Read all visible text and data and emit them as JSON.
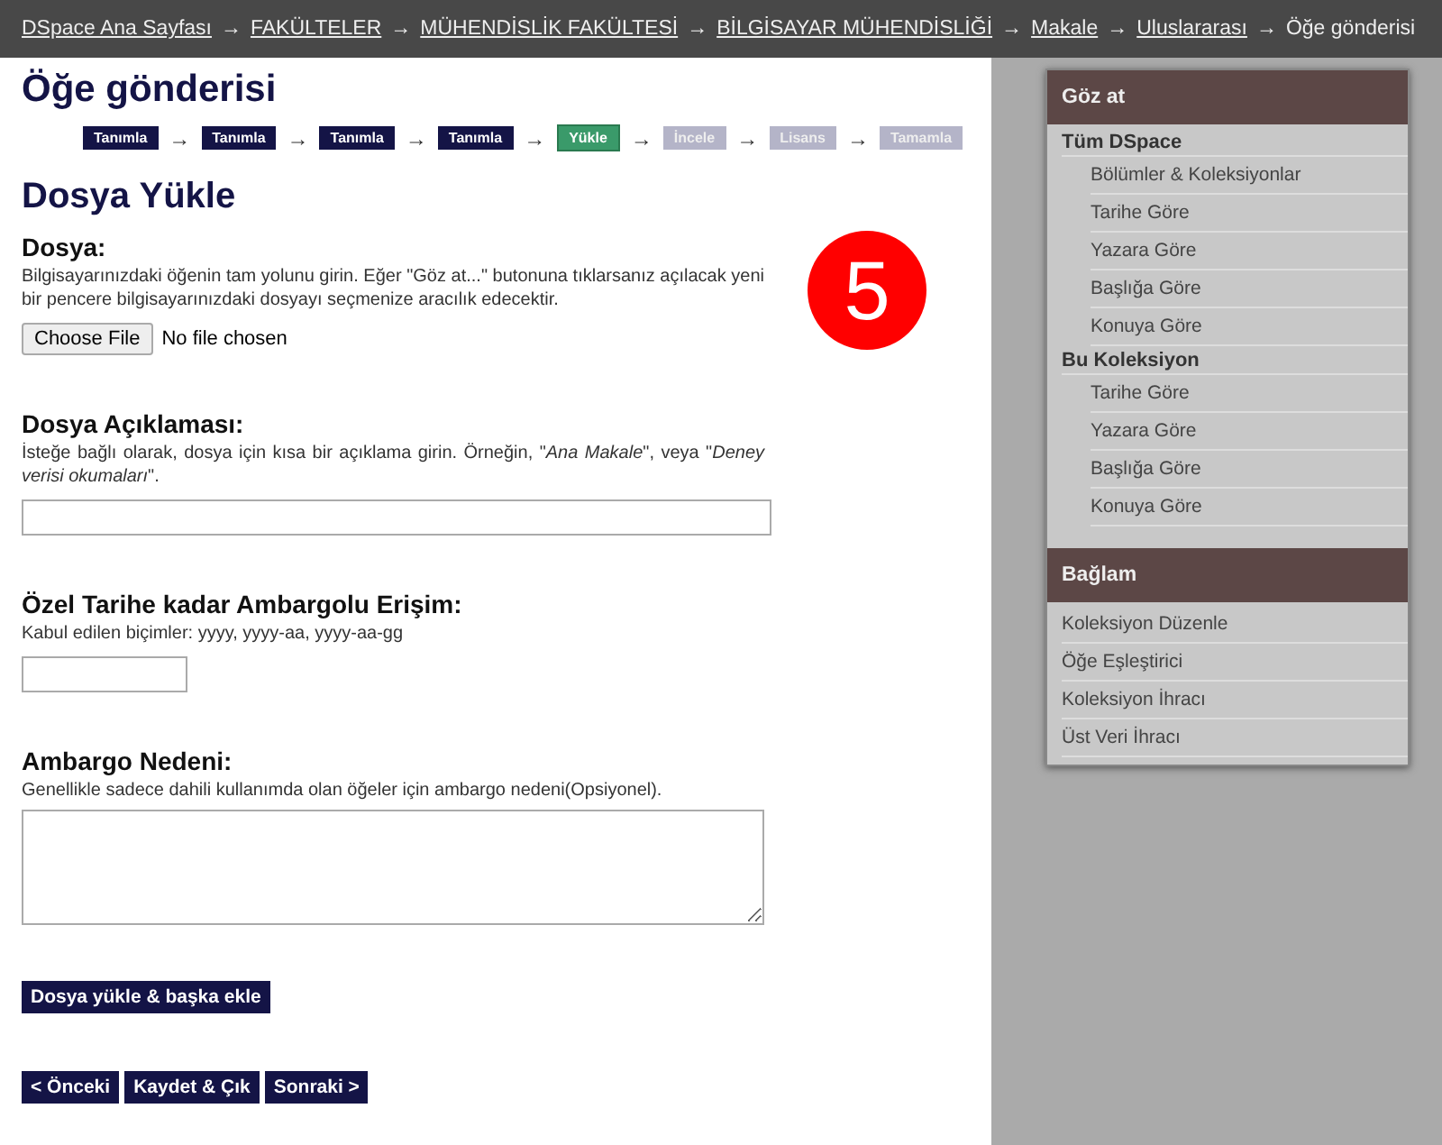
{
  "breadcrumb": {
    "separator": "→",
    "items": [
      {
        "label": "DSpace Ana Sayfası",
        "link": true
      },
      {
        "label": "FAKÜLTELER",
        "link": true
      },
      {
        "label": "MÜHENDİSLİK FAKÜLTESİ",
        "link": true
      },
      {
        "label": "BİLGİSAYAR MÜHENDİSLİĞİ",
        "link": true
      },
      {
        "label": "Makale",
        "link": true
      },
      {
        "label": "Uluslararası",
        "link": true
      },
      {
        "label": "Öğe gönderisi",
        "link": false
      }
    ]
  },
  "page_title": "Öğe gönderisi",
  "steps": {
    "separator": "→",
    "items": [
      {
        "label": "Tanımla",
        "kind": "done"
      },
      {
        "label": "Tanımla",
        "kind": "done"
      },
      {
        "label": "Tanımla",
        "kind": "done"
      },
      {
        "label": "Tanımla",
        "kind": "done"
      },
      {
        "label": "Yükle",
        "kind": "current"
      },
      {
        "label": "İncele",
        "kind": "todo"
      },
      {
        "label": "Lisans",
        "kind": "todo"
      },
      {
        "label": "Tamamla",
        "kind": "todo"
      }
    ]
  },
  "step_badge": "5",
  "section_title": "Dosya Yükle",
  "fields": [
    {
      "kind": "file",
      "label": "Dosya:",
      "help": "Bilgisayarınızdaki öğenin tam yolunu girin. Eğer \"Göz at...\" butonuna tıklarsanız açılacak yeni bir pencere bilgisayarınızdaki dosyayı seçmenize aracılık edecektir.",
      "button": "Choose File",
      "status": "No file chosen"
    },
    {
      "kind": "text",
      "label": "Dosya Açıklaması:",
      "help": "İsteğe bağlı olarak, dosya için kısa bir açıklama girin. Örneğin, \"*Ana Makale*\", veya \"*Deney verisi okumaları*\"."
    },
    {
      "kind": "date",
      "label": "Özel Tarihe kadar Ambargolu Erişim:",
      "help": "Kabul edilen biçimler: yyyy, yyyy-aa, yyyy-aa-gg"
    },
    {
      "kind": "textarea",
      "label": "Ambargo Nedeni:",
      "help": "Genellikle sadece dahili kullanımda olan öğeler için ambargo nedeni(Opsiyonel)."
    }
  ],
  "upload_button": "Dosya yükle & başka ekle",
  "nav_buttons": [
    "< Önceki",
    "Kaydet & Çık",
    "Sonraki >"
  ],
  "sidebar": [
    {
      "title": "Göz at",
      "groups": [
        {
          "heading": "Tüm DSpace",
          "items": [
            "Bölümler & Koleksiyonlar",
            "Tarihe Göre",
            "Yazara Göre",
            "Başlığa Göre",
            "Konuya Göre"
          ]
        },
        {
          "heading": "Bu Koleksiyon",
          "items": [
            "Tarihe Göre",
            "Yazara Göre",
            "Başlığa Göre",
            "Konuya Göre"
          ]
        }
      ]
    },
    {
      "title": "Bağlam",
      "groups": [
        {
          "items": [
            "Koleksiyon Düzenle",
            "Öğe Eşleştirici",
            "Koleksiyon İhracı",
            "Üst Veri İhracı"
          ]
        }
      ]
    }
  ]
}
